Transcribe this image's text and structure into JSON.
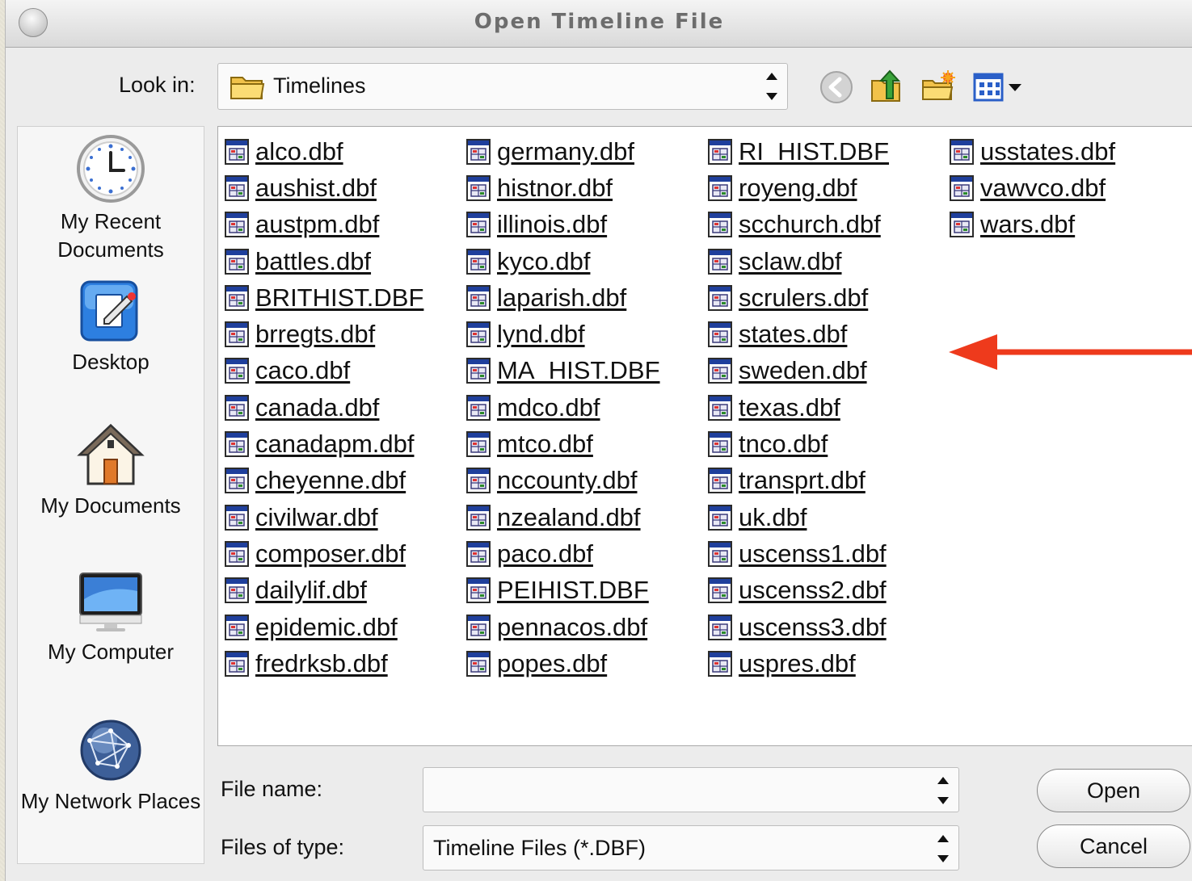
{
  "window": {
    "title": "Open Timeline File"
  },
  "look_in": {
    "label": "Look in:",
    "value": "Timelines"
  },
  "places": [
    {
      "label": "My Recent Documents",
      "icon": "clock-icon"
    },
    {
      "label": "Desktop",
      "icon": "desktop-icon"
    },
    {
      "label": "My Documents",
      "icon": "house-icon"
    },
    {
      "label": "My Computer",
      "icon": "monitor-icon"
    },
    {
      "label": "My Network Places",
      "icon": "globe-icon"
    }
  ],
  "files": {
    "col1": [
      "alco.dbf",
      "aushist.dbf",
      "austpm.dbf",
      "battles.dbf",
      "BRITHIST.DBF",
      "brregts.dbf",
      "caco.dbf",
      "canada.dbf",
      "canadapm.dbf",
      "cheyenne.dbf",
      "civilwar.dbf",
      "composer.dbf",
      "dailylif.dbf",
      "epidemic.dbf",
      "fredrksb.dbf"
    ],
    "col2": [
      "germany.dbf",
      "histnor.dbf",
      "illinois.dbf",
      "kyco.dbf",
      "laparish.dbf",
      "lynd.dbf",
      "MA_HIST.DBF",
      "mdco.dbf",
      "mtco.dbf",
      "nccounty.dbf",
      "nzealand.dbf",
      "paco.dbf",
      "PEIHIST.DBF",
      "pennacos.dbf",
      "popes.dbf"
    ],
    "col3": [
      "RI_HIST.DBF",
      "royeng.dbf",
      "scchurch.dbf",
      "sclaw.dbf",
      "scrulers.dbf",
      "states.dbf",
      "sweden.dbf",
      "texas.dbf",
      "tnco.dbf",
      "transprt.dbf",
      "uk.dbf",
      "uscenss1.dbf",
      "uscenss2.dbf",
      "uscenss3.dbf",
      "uspres.dbf"
    ],
    "col4": [
      "usstates.dbf",
      "vawvco.dbf",
      "wars.dbf"
    ]
  },
  "file_name": {
    "label": "File name:",
    "value": ""
  },
  "file_type": {
    "label": "Files of type:",
    "value": "Timeline Files (*.DBF)"
  },
  "buttons": {
    "open": "Open",
    "cancel": "Cancel"
  },
  "colors": {
    "annotation_arrow": "#ee3a1c",
    "accent_blue": "#2a5fc8"
  }
}
